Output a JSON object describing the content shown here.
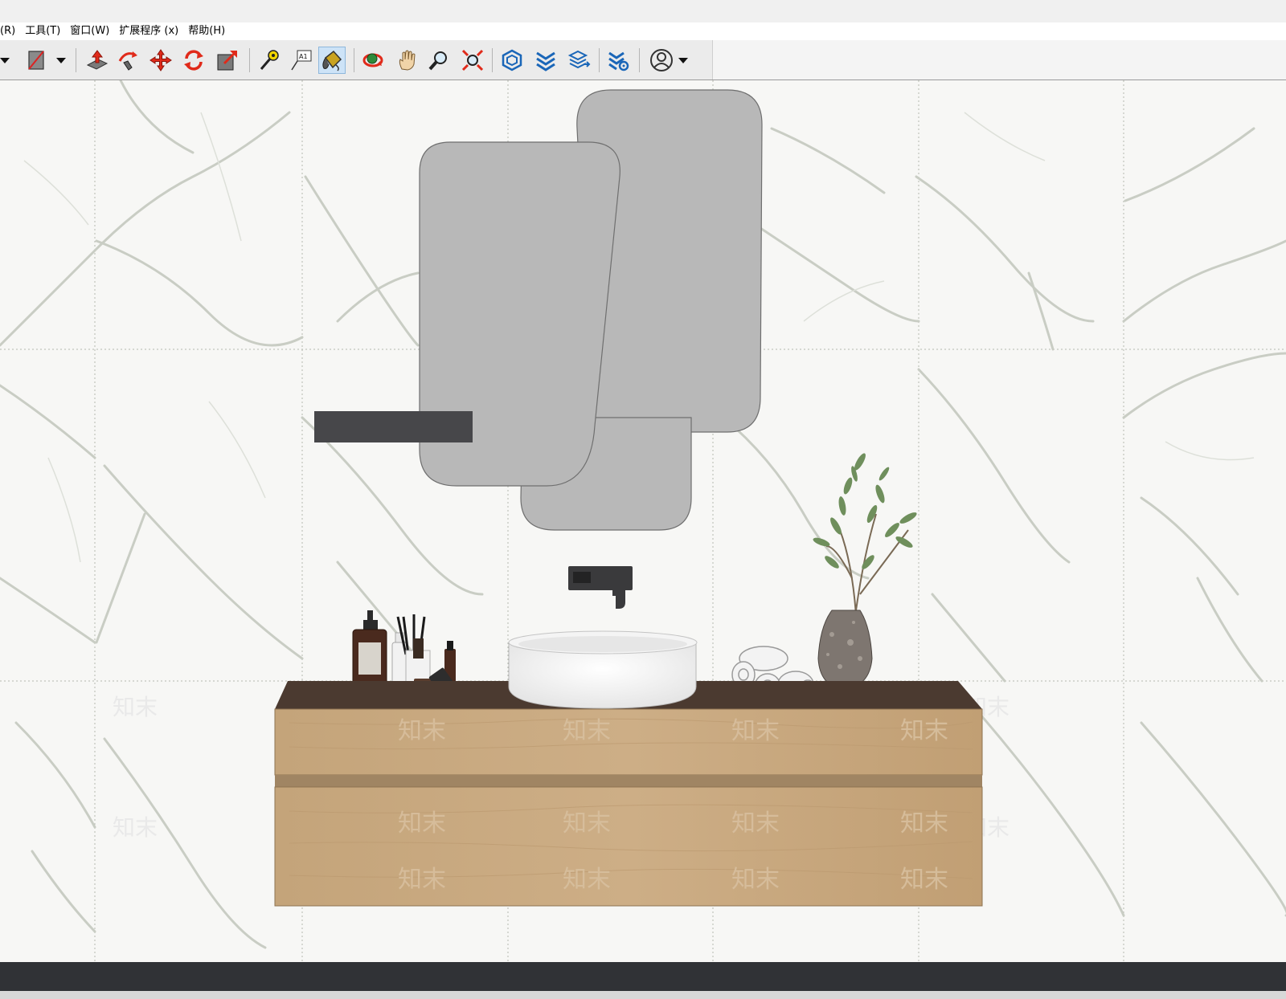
{
  "menu": {
    "items": [
      {
        "id": "render",
        "label": "(R)"
      },
      {
        "id": "tools",
        "label": "工具(T)"
      },
      {
        "id": "window",
        "label": "窗口(W)"
      },
      {
        "id": "extensions",
        "label": "扩展程序 (x)"
      },
      {
        "id": "help",
        "label": "帮助(H)"
      }
    ]
  },
  "toolbar": {
    "tools": [
      {
        "name": "style-dropdown-arrow-icon"
      },
      {
        "name": "section-plane-icon"
      },
      {
        "name": "section-dropdown-arrow-icon"
      },
      {
        "name": "push-pull-icon"
      },
      {
        "name": "follow-me-icon"
      },
      {
        "name": "move-icon"
      },
      {
        "name": "rotate-icon"
      },
      {
        "name": "scale-icon"
      },
      {
        "name": "tape-measure-icon"
      },
      {
        "name": "text-label-icon",
        "text": "A1"
      },
      {
        "name": "paint-bucket-icon",
        "active": true
      },
      {
        "name": "orbit-icon"
      },
      {
        "name": "pan-icon"
      },
      {
        "name": "zoom-icon"
      },
      {
        "name": "zoom-extents-icon"
      },
      {
        "name": "3d-warehouse-icon"
      },
      {
        "name": "extension-warehouse-icon"
      },
      {
        "name": "layout-send-icon"
      },
      {
        "name": "extension-manager-icon"
      },
      {
        "name": "account-icon"
      },
      {
        "name": "account-dropdown-arrow-icon"
      }
    ]
  },
  "scene": {
    "watermark": "知末",
    "colors": {
      "marble": "#f7f7f5",
      "vein": "#c9cdc4",
      "mirror": "#b8b8b8",
      "shelf": "#47474a",
      "countertop": "#4b3a30",
      "cabinet": "#c9a97f",
      "basin": "#fbfbfb",
      "faucet": "#3a3a3c",
      "status_bar": "#303236"
    }
  }
}
